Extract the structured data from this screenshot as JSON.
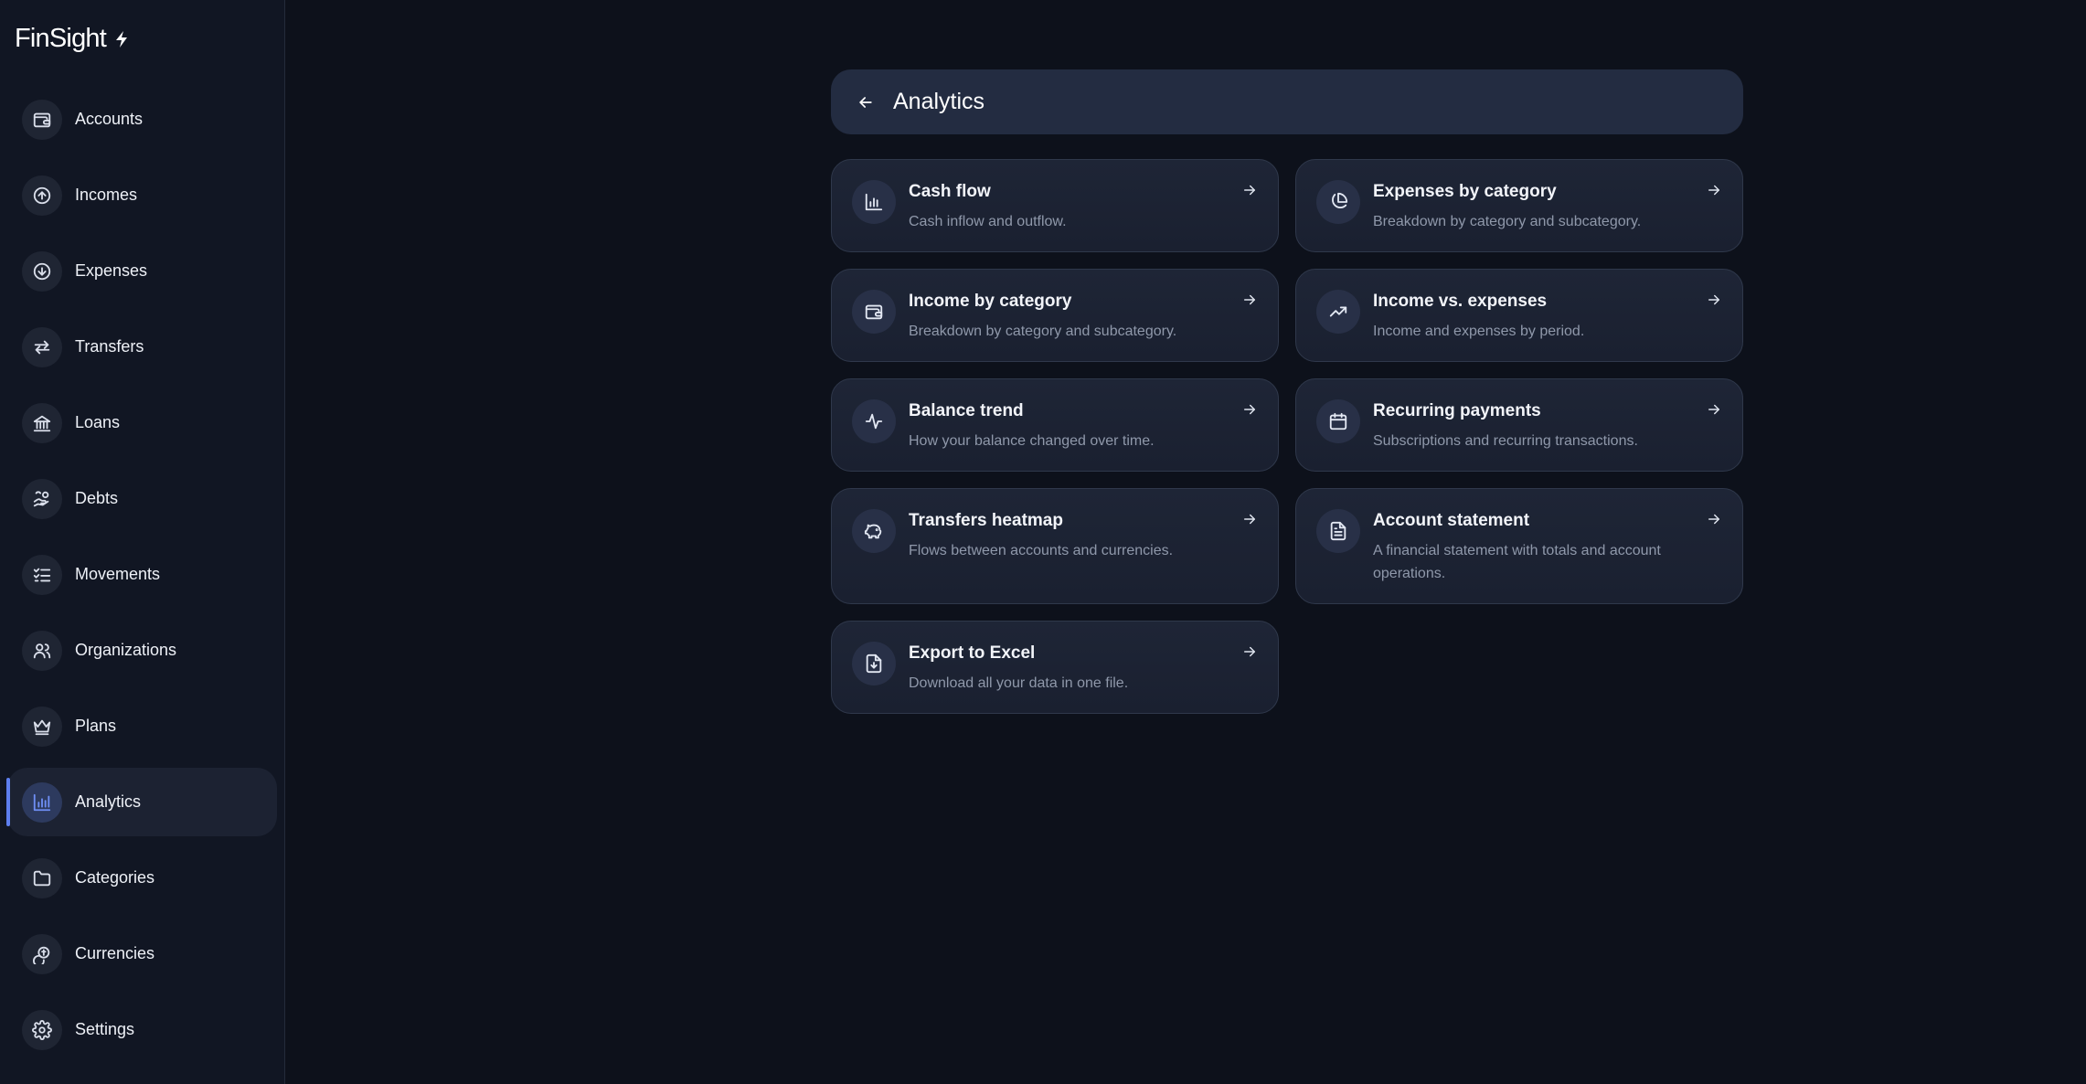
{
  "app": {
    "name": "FinSight"
  },
  "sidebar": {
    "items": [
      {
        "label": "Accounts",
        "icon": "wallet-icon"
      },
      {
        "label": "Incomes",
        "icon": "arrow-up-circle-icon"
      },
      {
        "label": "Expenses",
        "icon": "arrow-down-circle-icon"
      },
      {
        "label": "Transfers",
        "icon": "transfer-icon"
      },
      {
        "label": "Loans",
        "icon": "bank-icon"
      },
      {
        "label": "Debts",
        "icon": "hand-coins-icon"
      },
      {
        "label": "Movements",
        "icon": "list-checks-icon"
      },
      {
        "label": "Organizations",
        "icon": "users-icon"
      },
      {
        "label": "Plans",
        "icon": "crown-icon"
      },
      {
        "label": "Analytics",
        "icon": "bar-chart-icon",
        "active": true
      },
      {
        "label": "Categories",
        "icon": "folder-icon"
      },
      {
        "label": "Currencies",
        "icon": "coins-icon"
      },
      {
        "label": "Settings",
        "icon": "gear-icon"
      }
    ]
  },
  "header": {
    "title": "Analytics"
  },
  "cards": [
    {
      "title": "Cash flow",
      "description": "Cash inflow and outflow.",
      "icon": "bar-chart-icon"
    },
    {
      "title": "Expenses by category",
      "description": "Breakdown by category and subcategory.",
      "icon": "pie-chart-icon"
    },
    {
      "title": "Income by category",
      "description": "Breakdown by category and subcategory.",
      "icon": "wallet-icon"
    },
    {
      "title": "Income vs. expenses",
      "description": "Income and expenses by period.",
      "icon": "trending-up-icon"
    },
    {
      "title": "Balance trend",
      "description": "How your balance changed over time.",
      "icon": "activity-icon"
    },
    {
      "title": "Recurring payments",
      "description": "Subscriptions and recurring transactions.",
      "icon": "calendar-icon"
    },
    {
      "title": "Transfers heatmap",
      "description": "Flows between accounts and currencies.",
      "icon": "piggy-bank-icon"
    },
    {
      "title": "Account statement",
      "description": "A financial statement with totals and account operations.",
      "icon": "document-icon"
    },
    {
      "title": "Export to Excel",
      "description": "Download all your data in one file.",
      "icon": "file-download-icon"
    }
  ],
  "colors": {
    "background": "#0d111b",
    "sidebar": "#111623",
    "accent": "#5e7ff0",
    "card": "#1e2536"
  }
}
